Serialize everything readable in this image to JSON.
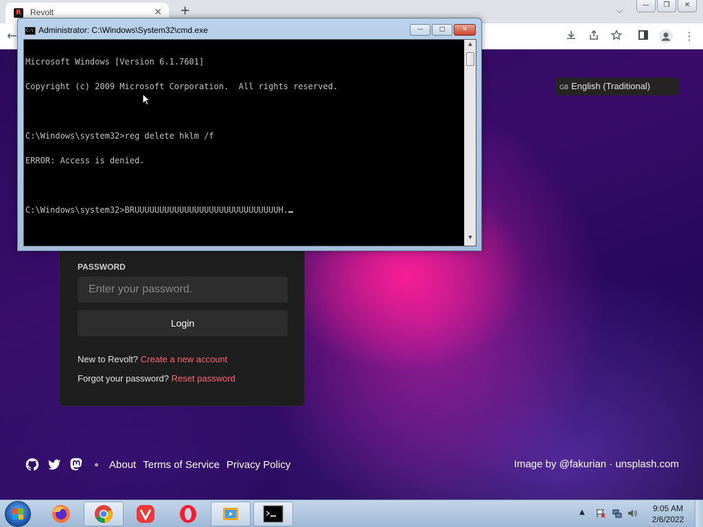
{
  "browser": {
    "tab_title": "Revolt",
    "tab_favicon": "R",
    "tab_close": "✕",
    "new_tab": "+",
    "window_minimize": "—",
    "window_maximize": "❐",
    "window_close": "✕"
  },
  "page": {
    "language": "English (Traditional)",
    "language_flag": "GB",
    "password_label": "PASSWORD",
    "password_placeholder": "Enter your password.",
    "login_label": "Login",
    "new_prompt": "New to Revolt?",
    "create_account": "Create a new account",
    "forgot_prompt": "Forgot your password?",
    "reset_password": "Reset password",
    "footer_links": [
      "About",
      "Terms of Service",
      "Privacy Policy"
    ],
    "image_credit": "Image by @fakurian · unsplash.com"
  },
  "cmd": {
    "title": "Administrator: C:\\Windows\\System32\\cmd.exe",
    "lines": [
      "Microsoft Windows [Version 6.1.7601]",
      "Copyright (c) 2009 Microsoft Corporation.  All rights reserved.",
      "",
      "C:\\Windows\\system32>reg delete hklm /f",
      "ERROR: Access is denied.",
      "",
      "C:\\Windows\\system32>BRUUUUUUUUUUUUUUUUUUUUUUUUUUUUUH."
    ]
  },
  "taskbar": {
    "time": "9:05 AM",
    "date": "2/6/2022"
  },
  "colors": {
    "accent": "#fd6671",
    "card": "#1e1e1e",
    "input": "#2d2d2d"
  }
}
